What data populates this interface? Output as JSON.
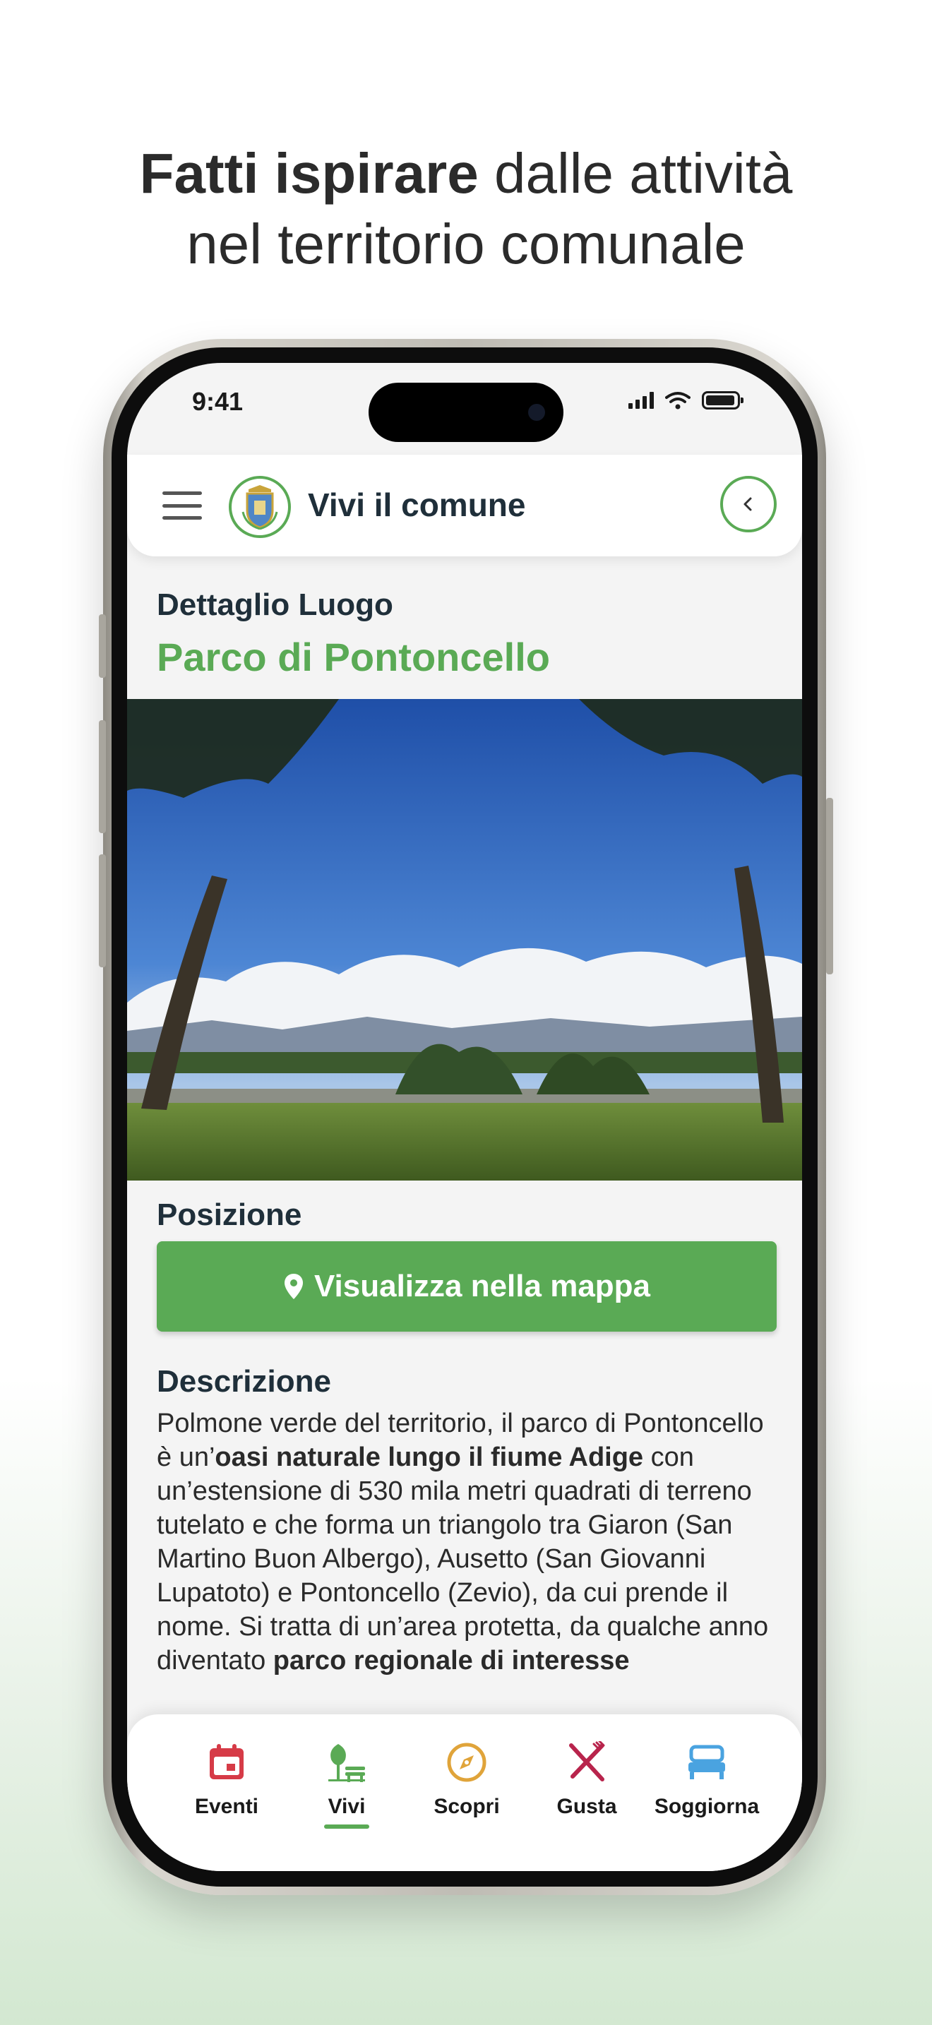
{
  "headline": {
    "bold": "Fatti ispirare",
    "rest": " dalle attività",
    "line2": "nel territorio comunale"
  },
  "status": {
    "time": "9:41"
  },
  "appbar": {
    "title": "Vivi il comune"
  },
  "page": {
    "section": "Dettaglio Luogo",
    "title": "Parco di Pontoncello",
    "position_label": "Posizione",
    "map_button": "Visualizza nella mappa",
    "description_label": "Descrizione"
  },
  "description": {
    "t1": "Polmone verde del territorio, il parco di Pontoncello è un’",
    "b1": "oasi naturale lungo il fiume Adige",
    "t2": " con un’estensione di 530 mila metri quadrati di terreno tutelato e che forma un triangolo tra Giaron (San Martino Buon Albergo), Ausetto (San Giovanni Lupatoto) e Pontoncello (Zevio), da cui prende il nome. Si tratta di un’area protetta, da qualche anno diventato ",
    "b2": "parco regionale di interesse"
  },
  "tabs": [
    {
      "label": "Eventi",
      "icon": "calendar-icon",
      "color": "#d63b47"
    },
    {
      "label": "Vivi",
      "icon": "tree-bench-icon",
      "color": "#5aaa55",
      "active": true
    },
    {
      "label": "Scopri",
      "icon": "compass-icon",
      "color": "#e0a43a"
    },
    {
      "label": "Gusta",
      "icon": "fork-knife-icon",
      "color": "#b8244c"
    },
    {
      "label": "Soggiorna",
      "icon": "bed-icon",
      "color": "#4aa3e0"
    }
  ],
  "colors": {
    "accent": "#5aaa55",
    "heading": "#1f2f3a"
  }
}
